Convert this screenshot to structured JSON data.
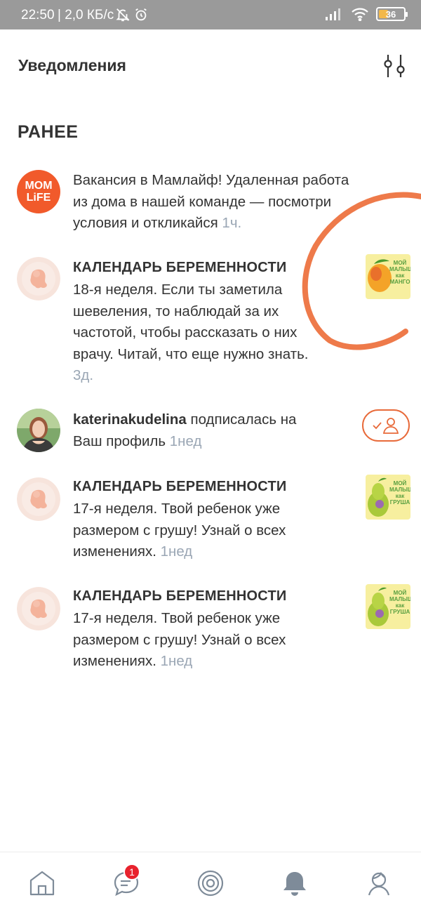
{
  "status_bar": {
    "time": "22:50",
    "network_speed": "| 2,0 КБ/с",
    "battery": "36",
    "battery_percent": 36
  },
  "header": {
    "title": "Уведомления"
  },
  "section": {
    "title": "РАНЕЕ"
  },
  "notifications": [
    {
      "avatar_text_line1": "MOM",
      "avatar_text_line2": "LiFE",
      "lines": [
        "Вакансия в Мамлайф! Удаленная работа",
        "из дома в нашей команде — посмотри",
        "условия и откликайся "
      ],
      "time": "1ч."
    },
    {
      "title": "КАЛЕНДАРЬ БЕРЕМЕННОСТИ",
      "lines": [
        "18-я неделя. Если ты заметила",
        "шевеления, то наблюдай за их",
        "частотой, чтобы рассказать о них",
        "врачу. Читай, что еще нужно знать."
      ],
      "time": "3д.",
      "thumb": {
        "line1": "МОЙ МАЛЫШ",
        "line2": "как",
        "line3": "МАНГО"
      }
    },
    {
      "username": "katerinakudelina",
      "lines": [
        " подписалась на",
        "Ваш профиль "
      ],
      "time": "1нед"
    },
    {
      "title": "КАЛЕНДАРЬ БЕРЕМЕННОСТИ",
      "lines": [
        "17-я неделя. Твой ребенок уже",
        "размером с грушу! Узнай о всех",
        "изменениях. "
      ],
      "time": "1нед",
      "thumb": {
        "line1": "МОЙ МАЛЫШ",
        "line2": "как",
        "line3": "ГРУША"
      }
    },
    {
      "title": "КАЛЕНДАРЬ БЕРЕМЕННОСТИ",
      "lines": [
        "17-я неделя. Твой ребенок уже",
        "размером с грушу! Узнай о всех",
        "изменениях. "
      ],
      "time": "1нед",
      "thumb": {
        "line1": "МОЙ МАЛЫШ",
        "line2": "как",
        "line3": "ГРУША"
      }
    }
  ],
  "bottom_nav": {
    "messages_badge": "1",
    "items": [
      "home-icon",
      "messages-icon",
      "target-icon",
      "bell-icon",
      "profile-icon"
    ]
  },
  "colors": {
    "accent": "#e86a3a",
    "annotation": "#ee7a4a",
    "time": "#9aa6b4",
    "badge": "#e8222d"
  }
}
